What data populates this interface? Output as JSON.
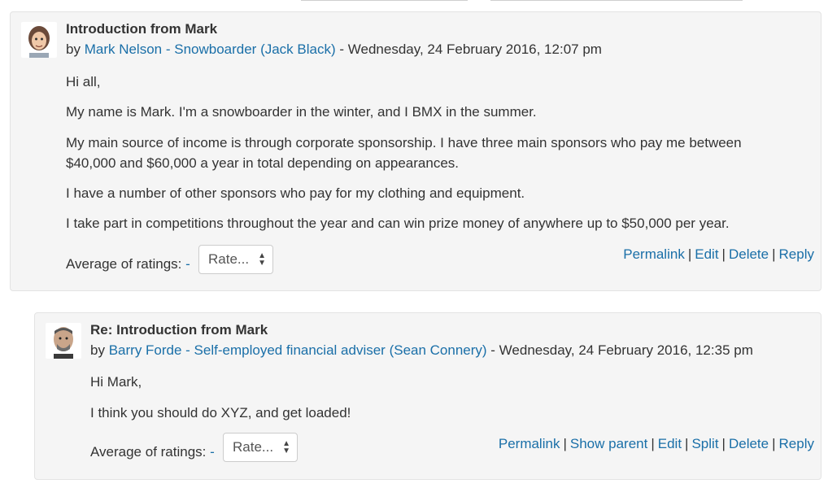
{
  "posts": [
    {
      "subject": "Introduction from Mark",
      "by_prefix": "by",
      "author": "Mark Nelson - Snowboarder (Jack Black)",
      "date": " - Wednesday, 24 February 2016, 12:07 pm",
      "paragraphs": [
        "Hi all,",
        "My name is Mark. I'm a snowboarder in the winter, and I BMX in the summer.",
        "My main source of income is through corporate sponsorship. I have three main sponsors who pay me between $40,000 and $60,000 a year in total depending on appearances.",
        "I have a number of other sponsors who pay for my clothing and equipment.",
        "I take part in competitions throughout the year and can win prize money of anywhere up to $50,000 per year."
      ],
      "rating_label": "Average of ratings:",
      "rating_value": "-",
      "rate_select": "Rate...",
      "commands": [
        "Permalink",
        "Edit",
        "Delete",
        "Reply"
      ]
    },
    {
      "subject": "Re: Introduction from Mark",
      "by_prefix": "by",
      "author": "Barry Forde - Self-employed financial adviser (Sean Connery)",
      "date": " - Wednesday, 24 February 2016, 12:35 pm",
      "paragraphs": [
        "Hi Mark,",
        "I think you should do XYZ, and get loaded!"
      ],
      "rating_label": "Average of ratings:",
      "rating_value": "-",
      "rate_select": "Rate...",
      "commands": [
        "Permalink",
        "Show parent",
        "Edit",
        "Split",
        "Delete",
        "Reply"
      ]
    }
  ],
  "colors": {
    "link": "#1a6fa8",
    "panel_bg": "#f5f5f5",
    "border": "#e3e3e3",
    "text": "#333333"
  },
  "icons": {
    "select": "up-down-chevron-icon"
  }
}
